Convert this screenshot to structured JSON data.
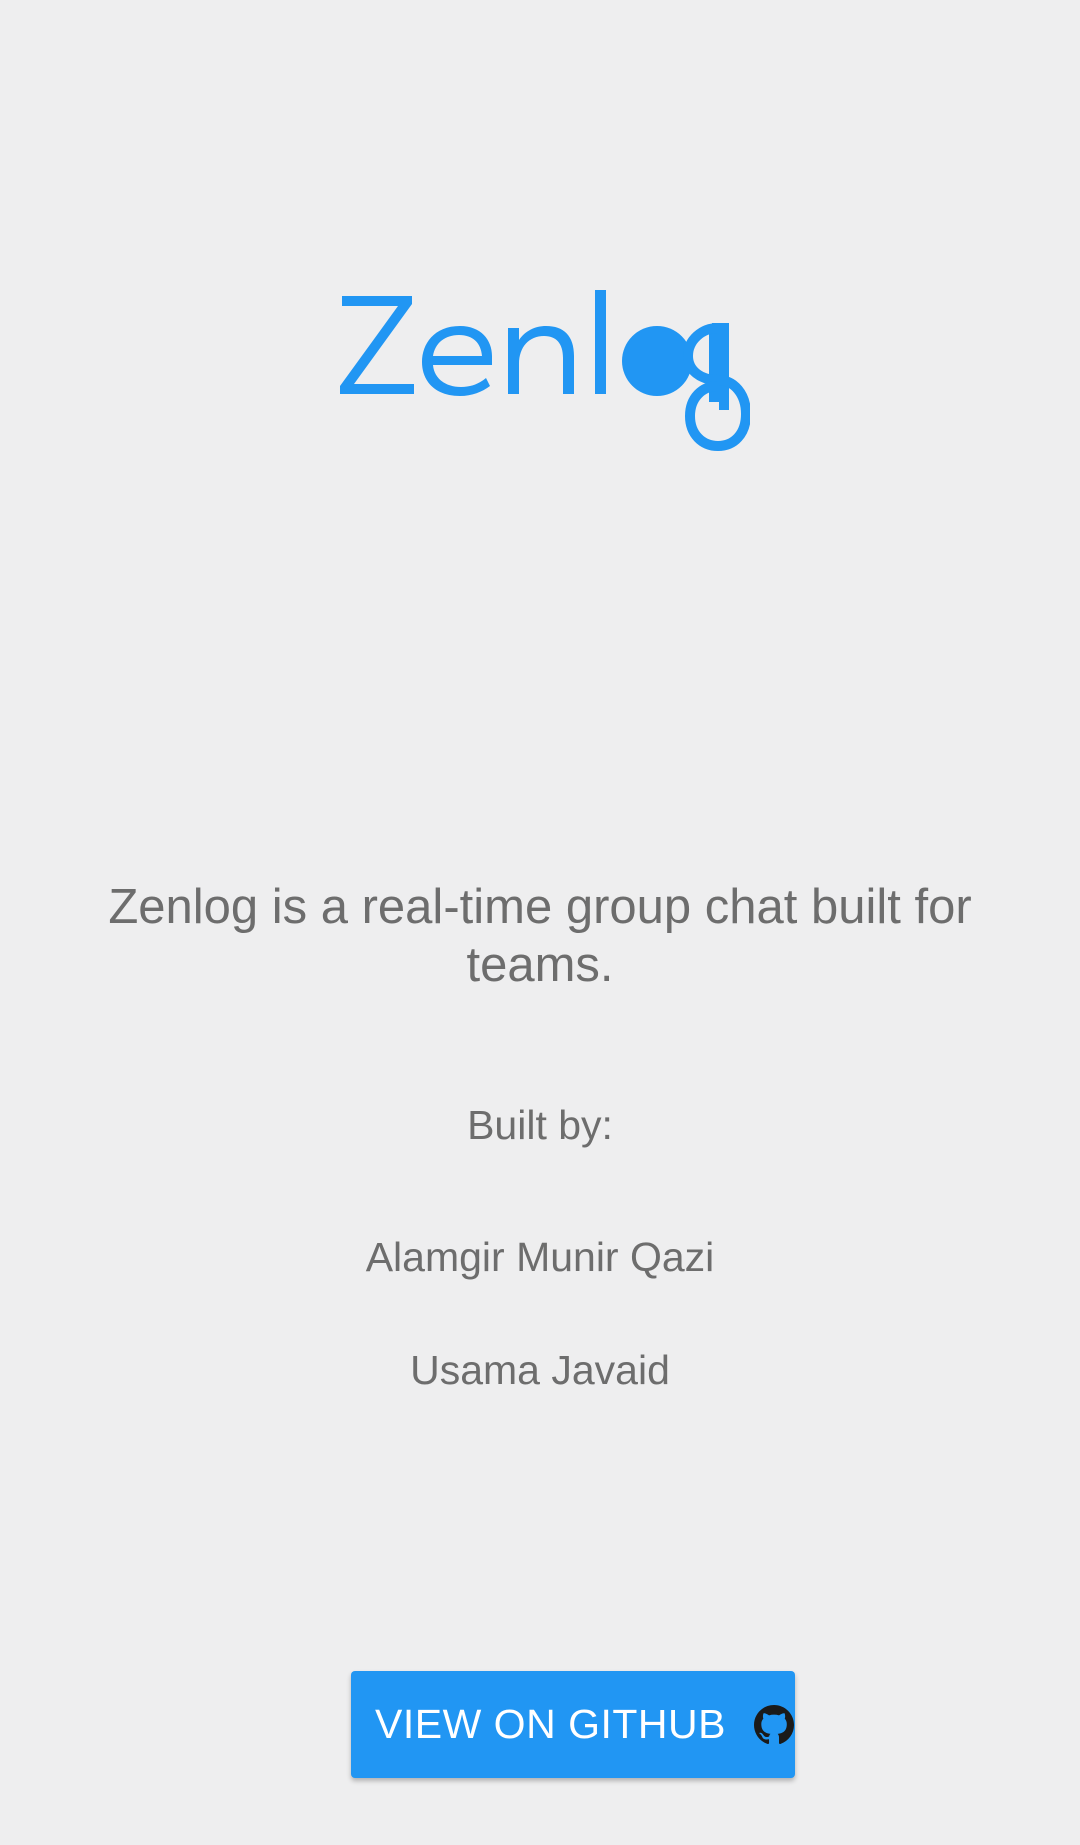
{
  "app": {
    "logo_text": "Zenlog",
    "brand_color": "#2196f3",
    "text_color": "#6d6d6d",
    "background_color": "#eeeeef"
  },
  "about": {
    "description": "Zenlog is a real-time group chat built for teams.",
    "built_by_label": "Built by:",
    "authors": [
      "Alamgir Munir Qazi",
      "Usama Javaid"
    ]
  },
  "actions": {
    "github_button_label": "VIEW ON GITHUB",
    "github_icon": "github-icon"
  }
}
